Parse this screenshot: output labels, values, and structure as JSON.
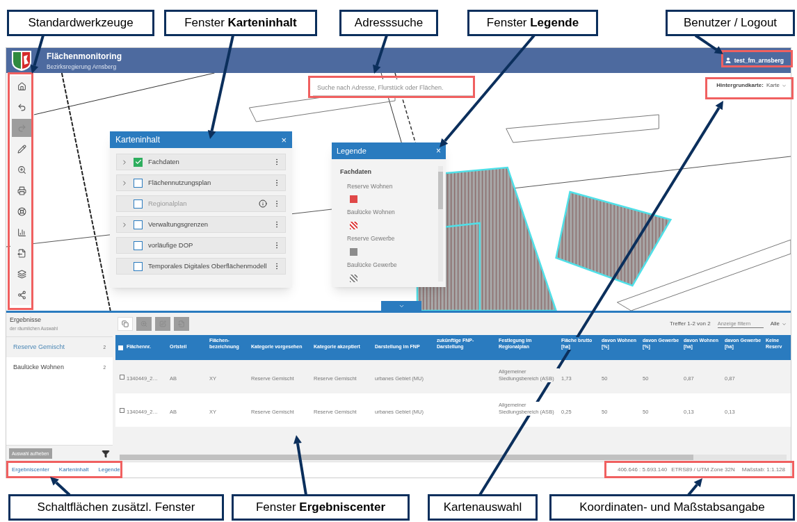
{
  "annotations_top": [
    {
      "text": "Standardwerkzeuge"
    },
    {
      "text": "Fenster **Karteninhalt**"
    },
    {
      "text": "Adresssuche"
    },
    {
      "text": "Fenster **Legende**"
    },
    {
      "text": "Benutzer / Logout"
    }
  ],
  "header": {
    "title": "Flächenmonitoring",
    "subtitle": "Bezirksregierung Arnsberg",
    "user": "test_fm_arnsberg"
  },
  "tools": [
    {
      "kind": "home",
      "disabled": false
    },
    {
      "kind": "undo",
      "disabled": false
    },
    {
      "kind": "redo",
      "disabled": true
    },
    {
      "kind": "draw",
      "disabled": false
    },
    {
      "kind": "zoom",
      "disabled": false
    },
    {
      "kind": "print",
      "disabled": false
    },
    {
      "kind": "help",
      "disabled": false
    },
    {
      "kind": "chart",
      "disabled": false
    },
    {
      "kind": "export",
      "disabled": false
    },
    {
      "kind": "layers",
      "disabled": false
    },
    {
      "kind": "share",
      "disabled": false
    }
  ],
  "search": {
    "placeholder": "Suche nach Adresse, Flurstück oder Flächen."
  },
  "background_map": {
    "label": "Hintergrundkarte:",
    "value": "Karte"
  },
  "karteninhalt": {
    "title": "Karteninhalt",
    "close": "×",
    "layers": [
      {
        "name": "Fachdaten",
        "expandable": true,
        "checked": true,
        "disabled": false,
        "info": false
      },
      {
        "name": "Flächennutzungsplan",
        "expandable": true,
        "checked": false,
        "disabled": false,
        "info": false
      },
      {
        "name": "Regionalplan",
        "expandable": false,
        "checked": false,
        "disabled": true,
        "info": true
      },
      {
        "name": "Verwaltungsgrenzen",
        "expandable": true,
        "checked": false,
        "disabled": false,
        "info": false
      },
      {
        "name": "vorläufige DOP",
        "expandable": false,
        "checked": false,
        "disabled": false,
        "info": false
      },
      {
        "name": "Temporales Digitales Oberflächenmodell",
        "expandable": false,
        "checked": false,
        "disabled": false,
        "info": false
      }
    ]
  },
  "legende": {
    "title": "Legende",
    "close": "×",
    "group": "Fachdaten",
    "items": [
      {
        "label": "Reserve Wohnen",
        "kind": "solid",
        "color": "#e04848"
      },
      {
        "label": "Baulücke Wohnen",
        "kind": "hatched",
        "color": "#e04848"
      },
      {
        "label": "Reserve Gewerbe",
        "kind": "solid",
        "color": "#8c8c8c"
      },
      {
        "label": "Baulücke Gewerbe",
        "kind": "hatched",
        "color": "#8c8c8c"
      }
    ]
  },
  "results": {
    "title": "Ergebnisse",
    "subtitle": "der räumlichen Auswahl",
    "categories": [
      {
        "name": "Reserve Gemischt",
        "count": "2",
        "selected": true
      },
      {
        "name": "Baulücke Wohnen",
        "count": "2",
        "selected": false
      }
    ],
    "clear_button": "Auswahl aufheben",
    "result_tools": [
      {
        "kind": "copy",
        "disabled": false
      },
      {
        "kind": "zoom",
        "disabled": true
      },
      {
        "kind": "edit",
        "disabled": true
      },
      {
        "kind": "export",
        "disabled": true
      }
    ],
    "select_all_checked": false,
    "hits": "Treffer 1-2 von 2",
    "filter_placeholder": "Anzeige filtern",
    "filter_select": "Alle",
    "columns": [
      "Flächennr.",
      "Ortsteil",
      "Flächen-bezeichnung",
      "Kategorie vorgesehen",
      "Kategorie akzeptiert",
      "Darstellung im FNP",
      "zukünftige FNP-Darstellung",
      "Festlegung im Regionalplan",
      "Fläche brutto [ha]",
      "davon Wohnen [%]",
      "davon Gewerbe [%]",
      "davon Wohnen [ha]",
      "davon Gewerbe [ha]",
      "Keine Reserv"
    ],
    "rows": [
      {
        "checked": false,
        "cells": [
          "1340449_2…",
          "AB",
          "XY",
          "Reserve Gemischt",
          "Reserve Gemischt",
          "urbanes Gebiet (MU)",
          null,
          "Allgemeiner Siedlungsbereich (ASB)",
          "1,73",
          "50",
          "50",
          "0,87",
          "0,87",
          null
        ]
      },
      {
        "checked": false,
        "cells": [
          "1340449_2…",
          "AB",
          "XY",
          "Reserve Gemischt",
          "Reserve Gemischt",
          "urbanes Gebiet (MU)",
          null,
          "Allgemeiner Siedlungsbereich (ASB)",
          "0,25",
          "50",
          "50",
          "0,13",
          "0,13",
          null
        ]
      }
    ]
  },
  "footer": {
    "links": [
      "Ergebniscenter",
      "Karteninhalt",
      "Legende"
    ],
    "coordinates": "406.646 : 5.693.140",
    "crs": "ETRS89 / UTM Zone 32N",
    "scale": "Maßstab: 1:1.128"
  },
  "annotations_bottom": [
    {
      "text": "Schaltflächen zusätzl. Fenster"
    },
    {
      "text": "Fenster **Ergebniscenter**"
    },
    {
      "text": "Kartenauswahl"
    },
    {
      "text": "Koordinaten- und Maßstabsangabe"
    }
  ]
}
